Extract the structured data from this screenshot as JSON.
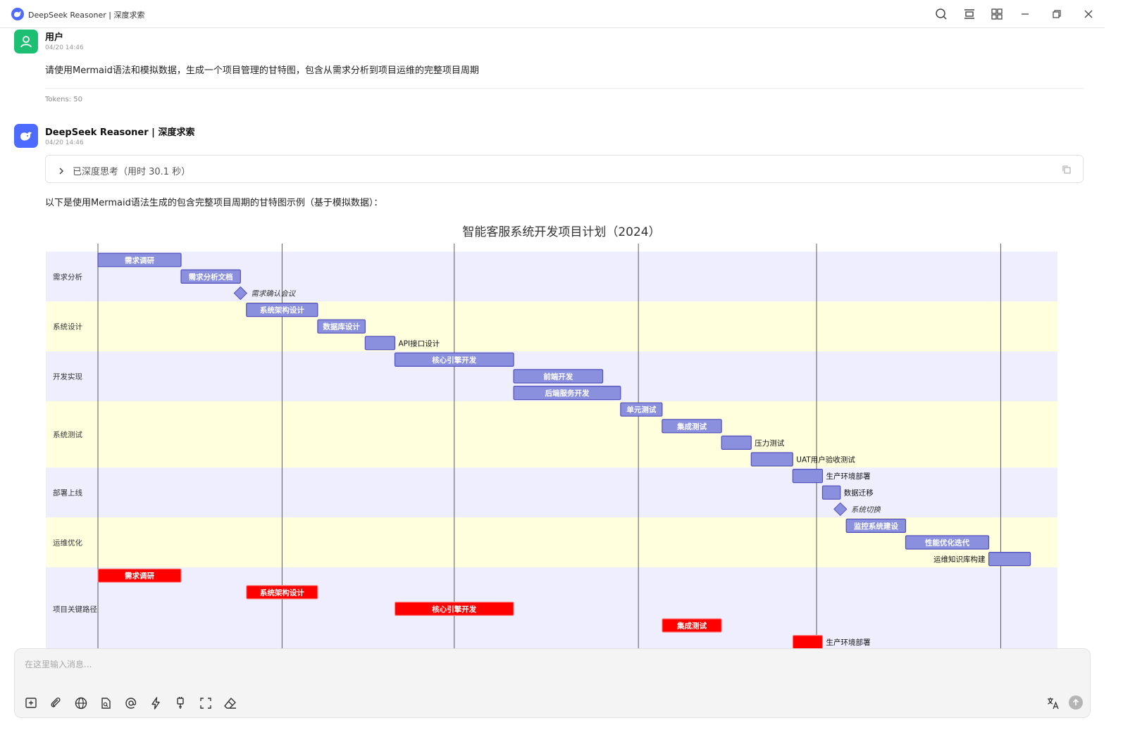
{
  "window": {
    "title": "DeepSeek Reasoner | 深度求索"
  },
  "conversation": {
    "user": {
      "name": "用户",
      "timestamp": "04/20 14:46",
      "message": "请使用Mermaid语法和模拟数据，生成一个项目管理的甘特图，包含从需求分析到项目运维的完整项目周期",
      "tokens": "Tokens: 50"
    },
    "assistant": {
      "name": "DeepSeek Reasoner | 深度求索",
      "timestamp": "04/20 14:46",
      "thinking_label": "已深度思考（用时 30.1 秒）",
      "intro": "以下是使用Mermaid语法生成的包含完整项目周期的甘特图示例（基于模拟数据）："
    }
  },
  "composer": {
    "placeholder": "在这里输入消息..."
  },
  "chart_data": {
    "type": "gantt",
    "title": "智能客服系统开发项目计划（2024）",
    "sections": [
      "需求分析",
      "系统设计",
      "开发实现",
      "系统测试",
      "部署上线",
      "运维优化",
      "项目关键路径"
    ],
    "tasks": [
      {
        "section": "需求分析",
        "name": "需求调研",
        "start": 0,
        "end": 14,
        "kind": "task",
        "label": "inside"
      },
      {
        "section": "需求分析",
        "name": "需求分析文档",
        "start": 14,
        "end": 24,
        "kind": "task",
        "label": "inside"
      },
      {
        "section": "需求分析",
        "name": "需求确认会议",
        "start": 24,
        "end": 24,
        "kind": "milestone",
        "label": "right"
      },
      {
        "section": "系统设计",
        "name": "系统架构设计",
        "start": 25,
        "end": 37,
        "kind": "task",
        "label": "inside"
      },
      {
        "section": "系统设计",
        "name": "数据库设计",
        "start": 37,
        "end": 45,
        "kind": "task",
        "label": "inside"
      },
      {
        "section": "系统设计",
        "name": "API接口设计",
        "start": 45,
        "end": 50,
        "kind": "task",
        "label": "right"
      },
      {
        "section": "开发实现",
        "name": "核心引擎开发",
        "start": 50,
        "end": 70,
        "kind": "task",
        "label": "inside"
      },
      {
        "section": "开发实现",
        "name": "前端开发",
        "start": 70,
        "end": 85,
        "kind": "task",
        "label": "inside"
      },
      {
        "section": "开发实现",
        "name": "后端服务开发",
        "start": 70,
        "end": 88,
        "kind": "task",
        "label": "inside"
      },
      {
        "section": "系统测试",
        "name": "单元测试",
        "start": 88,
        "end": 95,
        "kind": "task",
        "label": "inside"
      },
      {
        "section": "系统测试",
        "name": "集成测试",
        "start": 95,
        "end": 105,
        "kind": "task",
        "label": "inside"
      },
      {
        "section": "系统测试",
        "name": "压力测试",
        "start": 105,
        "end": 110,
        "kind": "task",
        "label": "right"
      },
      {
        "section": "系统测试",
        "name": "UAT用户验收测试",
        "start": 110,
        "end": 117,
        "kind": "task",
        "label": "right"
      },
      {
        "section": "部署上线",
        "name": "生产环境部署",
        "start": 117,
        "end": 122,
        "kind": "task",
        "label": "right"
      },
      {
        "section": "部署上线",
        "name": "数据迁移",
        "start": 122,
        "end": 125,
        "kind": "task",
        "label": "right"
      },
      {
        "section": "部署上线",
        "name": "系统切换",
        "start": 125,
        "end": 125,
        "kind": "milestone",
        "label": "right"
      },
      {
        "section": "运维优化",
        "name": "监控系统建设",
        "start": 126,
        "end": 136,
        "kind": "task",
        "label": "inside"
      },
      {
        "section": "运维优化",
        "name": "性能优化迭代",
        "start": 136,
        "end": 150,
        "kind": "task",
        "label": "inside"
      },
      {
        "section": "运维优化",
        "name": "运维知识库构建",
        "start": 150,
        "end": 157,
        "kind": "task",
        "label": "left"
      },
      {
        "section": "项目关键路径",
        "name": "需求调研",
        "start": 0,
        "end": 14,
        "kind": "crit",
        "label": "inside"
      },
      {
        "section": "项目关键路径",
        "name": "系统架构设计",
        "start": 25,
        "end": 37,
        "kind": "crit",
        "label": "inside"
      },
      {
        "section": "项目关键路径",
        "name": "核心引擎开发",
        "start": 50,
        "end": 70,
        "kind": "crit",
        "label": "inside"
      },
      {
        "section": "项目关键路径",
        "name": "集成测试",
        "start": 95,
        "end": 105,
        "kind": "crit",
        "label": "inside"
      },
      {
        "section": "项目关键路径",
        "name": "生产环境部署",
        "start": 117,
        "end": 122,
        "kind": "crit",
        "label": "right"
      }
    ],
    "gridlines": [
      0,
      31,
      60,
      91,
      121,
      152
    ],
    "colors": {
      "task_fill": "#8a90dd",
      "task_stroke": "#534fbc",
      "crit_fill": "#ff0000",
      "crit_stroke": "#ff8888",
      "section_odd": "#eeeeff",
      "section_even": "#ffffde"
    }
  }
}
